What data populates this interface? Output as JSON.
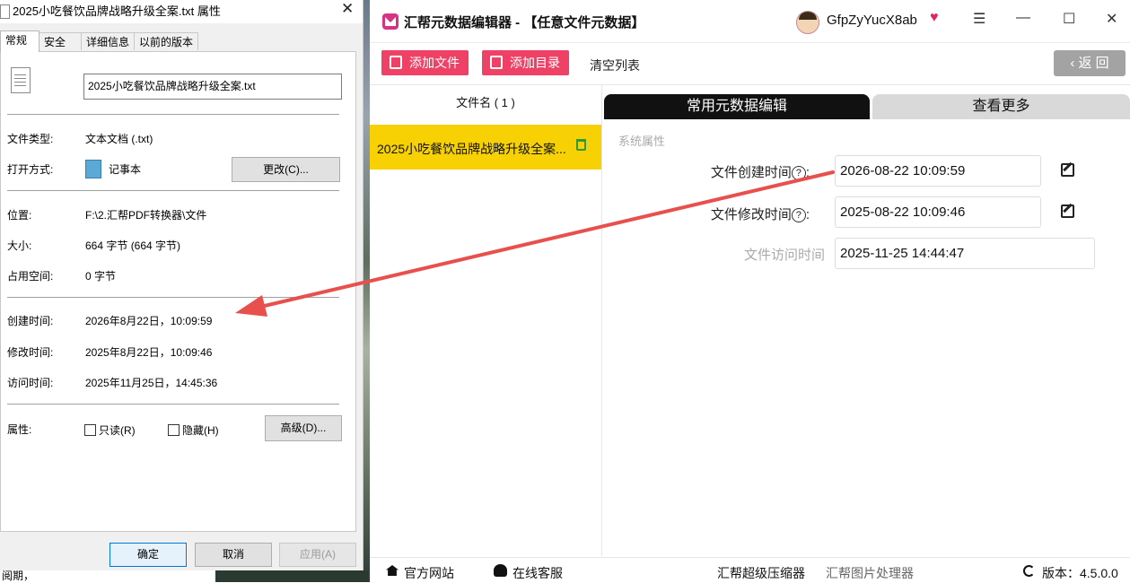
{
  "dialog": {
    "title": "2025小吃餐饮品牌战略升级全案.txt 属性",
    "close": "✕",
    "tabs": [
      "常规",
      "安全",
      "详细信息",
      "以前的版本"
    ],
    "filename": "2025小吃餐饮品牌战略升级全案.txt",
    "labels": {
      "type": "文件类型:",
      "open_with": "打开方式:",
      "location": "位置:",
      "size": "大小:",
      "disk_size": "占用空间:",
      "created": "创建时间:",
      "modified": "修改时间:",
      "accessed": "访问时间:",
      "attributes": "属性:"
    },
    "values": {
      "type": "文本文档 (.txt)",
      "open_with": "记事本",
      "location": "F:\\2.汇帮PDF转换器\\文件",
      "size": "664 字节 (664 字节)",
      "disk_size": "0 字节",
      "created": "2026年8月22日，10:09:59",
      "modified": "2025年8月22日，10:09:46",
      "accessed": "2025年11月25日，14:45:36"
    },
    "change_button": "更改(C)...",
    "readonly": "只读(R)",
    "hidden": "隐藏(H)",
    "advanced_button": "高级(D)...",
    "ok": "确定",
    "cancel": "取消",
    "apply": "应用(A)"
  },
  "behind": {
    "fragment": "阅期，"
  },
  "app": {
    "title": "汇帮元数据编辑器 - 【任意文件元数据】",
    "username": "GfpZyYucX8ab",
    "window_controls": [
      "☰",
      "—",
      "☐",
      "✕"
    ],
    "toolbar": {
      "add_file": "添加文件",
      "add_dir": "添加目录",
      "clear": "清空列表",
      "back": "返 回"
    },
    "list_header": "文件名 ( 1 )",
    "file_item": "2025小吃餐饮品牌战略升级全案...",
    "tabs": {
      "common": "常用元数据编辑",
      "more": "查看更多"
    },
    "section": "系统属性",
    "fields": {
      "created_label": "文件创建时间",
      "created_value": "2026-08-22 10:09:59",
      "modified_label": "文件修改时间",
      "modified_value": "2025-08-22 10:09:46",
      "accessed_label": "文件访问时间",
      "accessed_value": "2025-11-25 14:44:47",
      "help": "?",
      "colon": ":"
    },
    "status": {
      "website": "官方网站",
      "support": "在线客服",
      "compressor": "汇帮超级压缩器",
      "image_tool": "汇帮图片处理器",
      "version": "版本：4.5.0.0"
    }
  },
  "colors": {
    "accent": "#ee4165",
    "selected": "#f7d103",
    "arrow": "#e8504e"
  }
}
